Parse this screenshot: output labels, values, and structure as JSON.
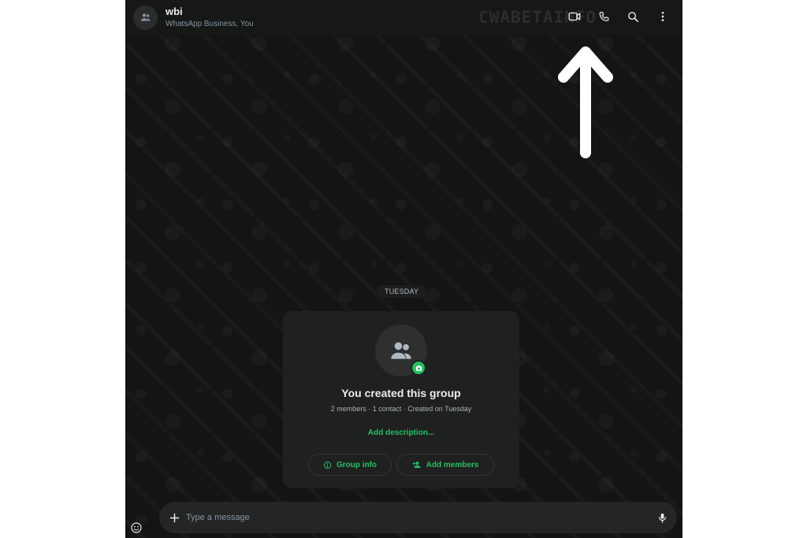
{
  "header": {
    "title": "wbi",
    "subtitle": "WhatsApp Business, You",
    "watermark": "CWABETAINFO",
    "icons": [
      "group-avatar-icon",
      "video-call-icon",
      "voice-call-icon",
      "search-icon",
      "more-options-icon"
    ]
  },
  "annotation": {
    "icon": "up-arrow-icon",
    "color": "#ffffff"
  },
  "chat": {
    "date_chip": "TUESDAY",
    "system_card": {
      "title": "You created this group",
      "subtitle": "2 members · 1 contact · Created on Tuesday",
      "add_description": "Add description...",
      "group_info_label": "Group info",
      "add_members_label": "Add members",
      "icons": [
        "group-icon",
        "camera-icon",
        "info-icon",
        "add-person-icon"
      ]
    }
  },
  "composer": {
    "placeholder": "Type a message",
    "icons": [
      "sticker-icon",
      "plus-icon",
      "microphone-icon"
    ]
  },
  "colors": {
    "accent": "#21c063",
    "background": "#141414",
    "header": "#161717",
    "card": "#1f2020",
    "text_primary": "#e9edef",
    "text_secondary": "#8696a0"
  }
}
